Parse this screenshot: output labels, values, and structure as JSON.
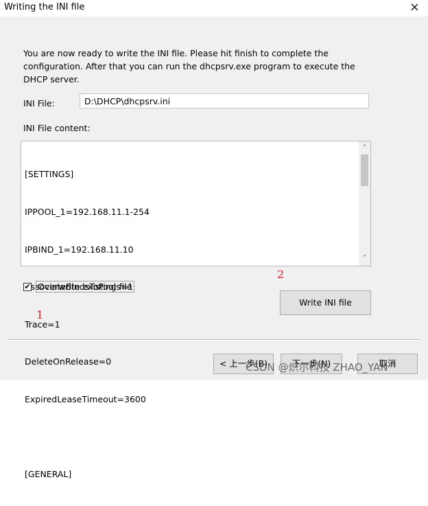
{
  "window": {
    "title": "Writing the INI file"
  },
  "intro_text": "You are now ready to write the INI file. Please hit finish to complete the configuration. After that you can run the dhcpsrv.exe program to execute the DHCP server.",
  "ini_file": {
    "label": "INI File:",
    "value": "D:\\DHCP\\dhcpsrv.ini"
  },
  "ini_content": {
    "label": "INI File content:",
    "lines": [
      "[SETTINGS]",
      "IPPOOL_1=192.168.11.1-254",
      "IPBIND_1=192.168.11.10",
      "AssociateBindsToPools=1",
      "Trace=1",
      "DeleteOnRelease=0",
      "ExpiredLeaseTimeout=3600",
      "",
      "[GENERAL]"
    ]
  },
  "overwrite": {
    "label": "Overwrite existing file",
    "checked": true,
    "checkmark": "✔"
  },
  "buttons": {
    "write_ini": "Write INI file",
    "back": "< 上一步(B)",
    "next": "下一步(N)",
    "cancel": "取消"
  },
  "annotations": {
    "one": "1",
    "two": "2"
  },
  "watermark": "CSDN @炽尔科技 ZHAO_YAN",
  "icons": {
    "close": "×",
    "scroll_up": "˄",
    "scroll_down": "˅"
  }
}
